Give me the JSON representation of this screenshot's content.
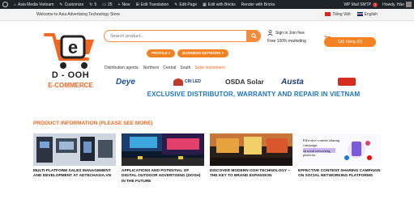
{
  "adminbar": {
    "site_name": "Asia Media Vietnam",
    "customize": "Customize",
    "updates": "5",
    "comments": "25",
    "new": "New",
    "edit_translation": "Edit Translation",
    "edit_page": "Edit Page",
    "edit_bricks": "Edit with Bricks",
    "render_bricks": "Render with Bricks",
    "smtp": "WP Mail SMTP",
    "smtp_count": "1",
    "howdy": "Howdy, Hảo"
  },
  "topbar": {
    "welcome": "Welcome to Asia Advertising Technology Store",
    "lang_vi": "Tiếng Việt",
    "lang_en": "English"
  },
  "logo": {
    "line1": "D - OOH",
    "line2": "E-COMMERCE"
  },
  "search": {
    "placeholder": "Search product..."
  },
  "menu": {
    "profile": "PROFILE",
    "network": "BUSINESS NETWORK"
  },
  "account": {
    "signin": "Sign in Join free",
    "marketing": "Free 100% marketing"
  },
  "cart": {
    "label": "Giỏ hàng (0)"
  },
  "agents": {
    "label": "Distribution agents:",
    "items": [
      "Northern",
      "Central",
      "South",
      "Solar investment"
    ]
  },
  "brands": [
    "Deye",
    "CRI LED",
    "OSDA Solar",
    "Austa",
    "Brand 5"
  ],
  "tagline": "EXCLUSIVE DISTRIBUTOR, WARRANTY AND REPAIR IN VIETNAM",
  "section_title": "PRODUCT INFORMATION (PLEASE SEE MORE)",
  "posts": [
    {
      "title": "MULTI-PLATFORM SALES MANAGEMENT AND DEVELOPMENT AT ADTECHASIA.VN"
    },
    {
      "title": "APPLICATIONS AND POTENTIAL OF DIGITAL OUTDOOR ADVERTISING (DOOH) IN THE FUTURE"
    },
    {
      "title": "DISCOVER MODERN OOH TECHNOLOGY – THE KEY TO BRAND EXPANSION"
    },
    {
      "title": "EFFECTIVE CONTENT SHARING CAMPAIGN ON SOCIAL NETWORKING PLATFORMS",
      "thumb_text_1": "Effective content sharing campaign",
      "thumb_text_2": "on social networking platforms"
    }
  ],
  "colors": {
    "accent": "#f58220",
    "blue": "#1a73c8",
    "adminbar": "#1d2327"
  }
}
